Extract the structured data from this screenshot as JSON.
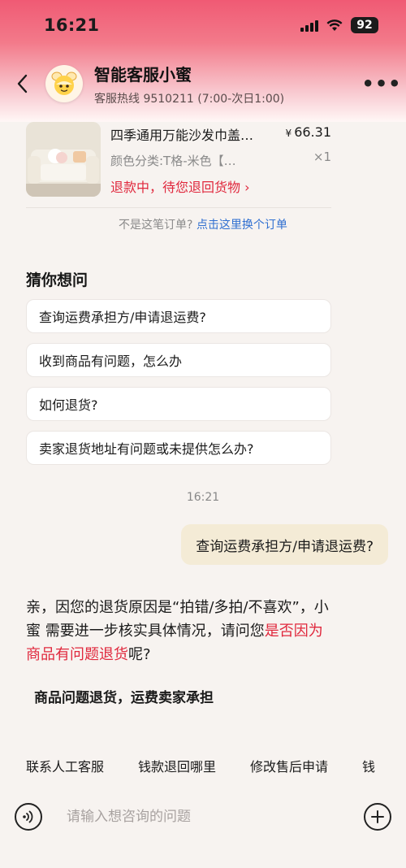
{
  "status_bar": {
    "time": "16:21",
    "battery": "92"
  },
  "header": {
    "title": "智能客服小蜜",
    "subtitle": "客服热线 9510211 (7:00-次日1:00)",
    "more_label": "•••"
  },
  "order": {
    "title": "四季通用万能沙发巾盖…",
    "price_symbol": "¥",
    "price": "66.31",
    "spec": "颜色分类:T格-米色【…",
    "quantity": "×1",
    "status": "退款中，待您退回货物 ›"
  },
  "switch_order": {
    "prefix": "不是这笔订单? ",
    "link": "点击这里换个订单"
  },
  "guess": {
    "title": "猜你想问",
    "questions": [
      "查询运费承担方/申请退运费?",
      "收到商品有问题，怎么办",
      "如何退货?",
      "卖家退货地址有问题或未提供怎么办?"
    ]
  },
  "chat": {
    "timestamp": "16:21",
    "user_message": "查询运费承担方/申请退运费?",
    "bot_part1": "亲，因您的退货原因是“拍错/多拍/不喜欢”，小蜜 需要进一步核实具体情况，请问您",
    "bot_highlight": "是否因为商品有问题退货",
    "bot_part2": "呢?",
    "bot_option": "商品问题退货，运费卖家承担"
  },
  "quick_actions": [
    "联系人工客服",
    "钱款退回哪里",
    "修改售后申请",
    "钱"
  ],
  "input": {
    "placeholder": "请输入想咨询的问题"
  },
  "colors": {
    "accent": "#e0283d",
    "link": "#2f6fd1",
    "bubble": "#f4ebd6"
  }
}
